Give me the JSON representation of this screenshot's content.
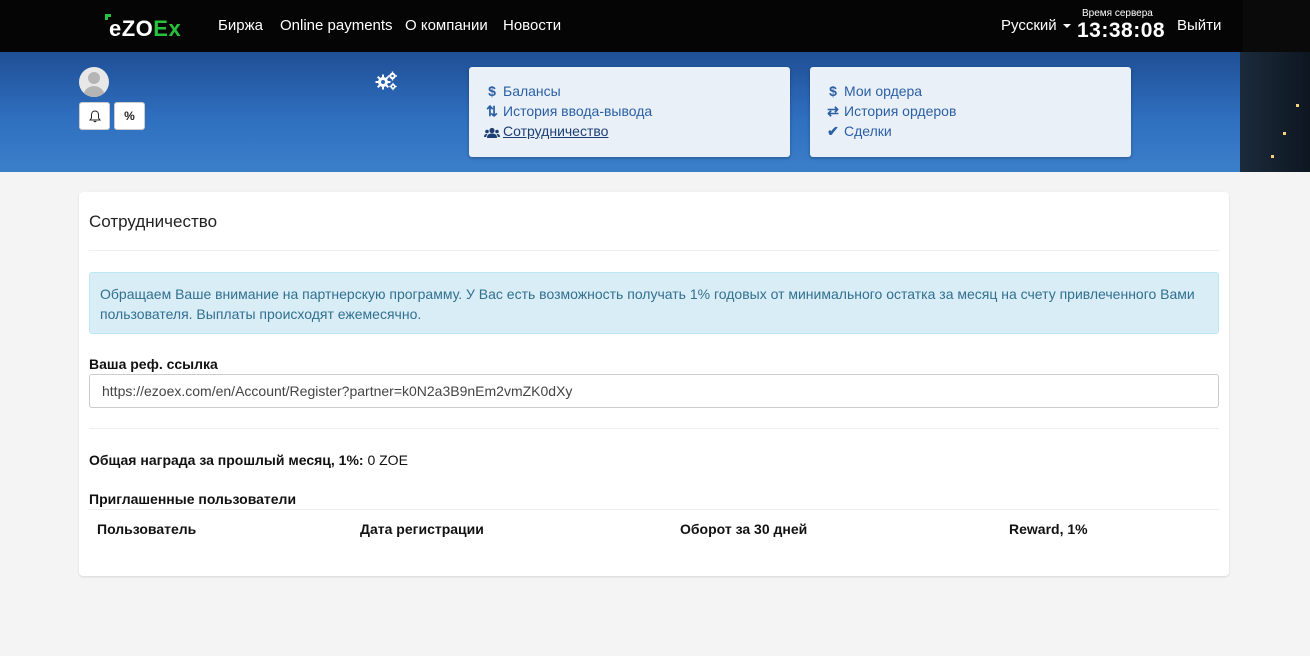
{
  "nav": {
    "logo_prefix": "eZO",
    "logo_suffix": "Ex",
    "items": [
      "Биржа",
      "Online payments",
      "О компании",
      "Новости"
    ],
    "language": "Русский",
    "server_time_label": "Время сервера",
    "server_time": "13:38:08",
    "logout": "Выйти"
  },
  "user": {
    "bell_label": "🔔",
    "percent_label": "%"
  },
  "panel_left": {
    "links": [
      {
        "icon": "$",
        "label": "Балансы"
      },
      {
        "icon": "⇅",
        "label": "История ввода-вывода"
      },
      {
        "icon": "👥",
        "label": "Сотрудничество"
      }
    ]
  },
  "panel_right": {
    "links": [
      {
        "icon": "$",
        "label": "Мои ордера"
      },
      {
        "icon": "⇄",
        "label": "История ордеров"
      },
      {
        "icon": "✔",
        "label": "Сделки"
      }
    ]
  },
  "card": {
    "title": "Сотрудничество",
    "alert": "Обращаем Ваше внимание на партнерскую программу. У Вас есть возможность получать 1% годовых от минимального остатка за месяц на счету привлеченного Вами пользователя. Выплаты происходят ежемесячно.",
    "ref_label": "Ваша реф. ссылка",
    "ref_value": "https://ezoex.com/en/Account/Register?partner=k0N2a3B9nEm2vmZK0dXy",
    "reward_label": "Общая награда за прошлый месяц, 1%:",
    "reward_value": "0 ZOE",
    "invited_title": "Приглашенные пользователи",
    "columns": [
      "Пользователь",
      "Дата регистрации",
      "Оборот за 30 дней",
      "Reward, 1%"
    ]
  },
  "colors": {
    "brand_green": "#27c23b",
    "navbar": "#050505",
    "link_blue": "#2a5fa4",
    "alert_bg": "#d9edf7"
  }
}
